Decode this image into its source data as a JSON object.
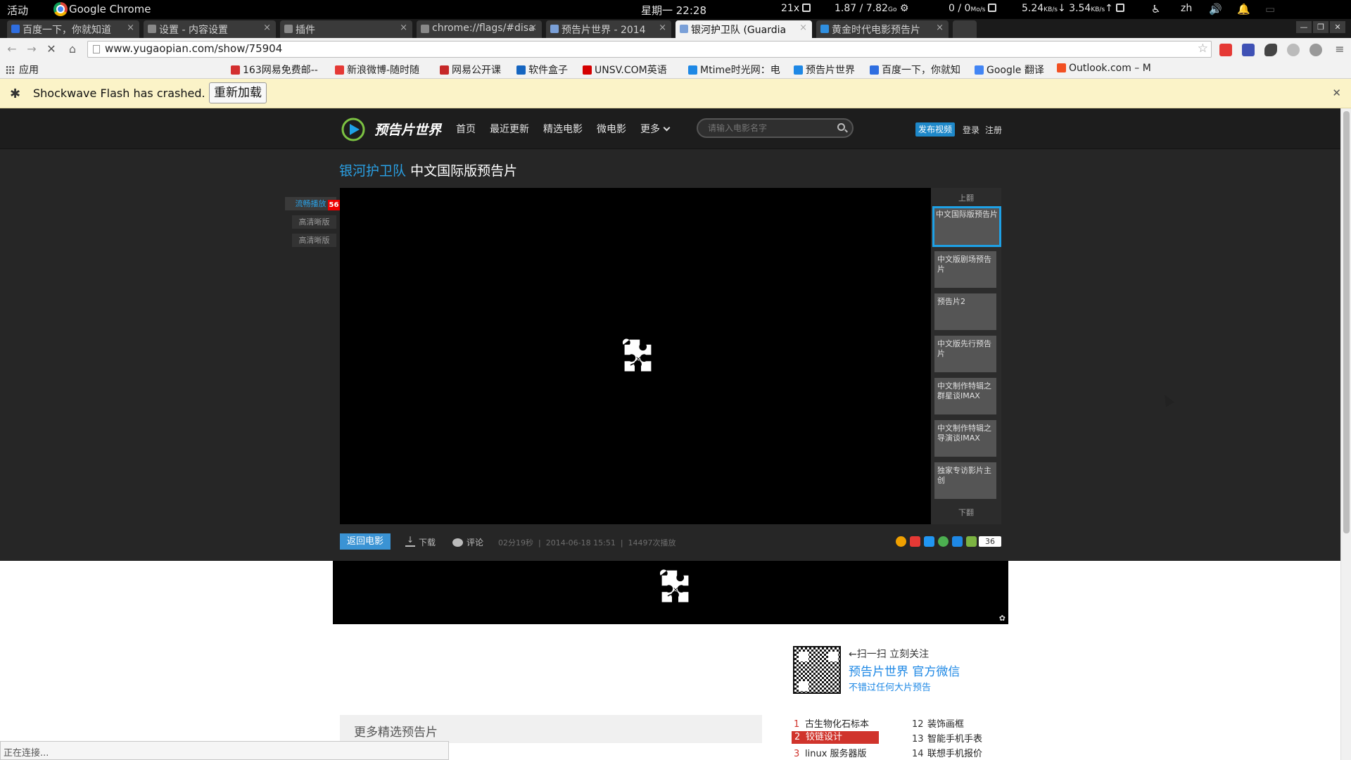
{
  "topbar": {
    "activities": "活动",
    "app_name": "Google Chrome",
    "clock": "星期一 22:28",
    "s1": "21x",
    "s2": "1.87 / 7.82",
    "s2_unit": "Go",
    "s3": "0 / 0",
    "s3_unit": "Mo/s",
    "down": "5.24",
    "up": "3.54",
    "net_unit": "KB/s",
    "lang": "zh"
  },
  "tabs": [
    {
      "label": "百度一下，你就知道",
      "color": "#2f6ee0"
    },
    {
      "label": "设置 - 内容设置",
      "color": "#888888"
    },
    {
      "label": "插件",
      "color": "#888888"
    },
    {
      "label": "chrome://flags/#disa",
      "color": "#888888"
    },
    {
      "label": "预告片世界 - 2014",
      "color": "#7aa0d8"
    },
    {
      "label": "银河护卫队 (Guardia",
      "color": "#7aa0d8"
    },
    {
      "label": "黄金时代电影预告片",
      "color": "#2f8fe0"
    }
  ],
  "omnibox": {
    "url": "www.yugaopian.com/show/75904"
  },
  "bookmarks": {
    "apps_label": "应用",
    "items": [
      {
        "label": "163网易免费邮--",
        "color": "#d32f2f"
      },
      {
        "label": "新浪微博-随时随",
        "color": "#e53935"
      },
      {
        "label": "网易公开课",
        "color": "#c62828"
      },
      {
        "label": "软件盒子",
        "color": "#1565c0"
      },
      {
        "label": "UNSV.COM英语",
        "color": "#d50000"
      },
      {
        "label": "Mtime时光网：电",
        "color": "#1e88e5"
      },
      {
        "label": "预告片世界",
        "color": "#1e88e5"
      },
      {
        "label": "百度一下，你就知",
        "color": "#2f6ee0"
      },
      {
        "label": "Google 翻译",
        "color": "#4285f4"
      },
      {
        "label": "Outlook.com – M",
        "color": "#f25022"
      }
    ]
  },
  "infobar": {
    "message": "Shockwave Flash has crashed.",
    "reload": "重新加载"
  },
  "site": {
    "logo": "预告片世界",
    "nav": [
      "首页",
      "最近更新",
      "精选电影",
      "微电影",
      "更多"
    ],
    "search_placeholder": "请输入电影名字",
    "publish": "发布视频",
    "login": "登录",
    "register": "注册"
  },
  "movie": {
    "name": "银河护卫队",
    "version": "中文国际版预告片"
  },
  "sources": {
    "items": [
      "流畅播放",
      "高清晰版",
      "高清晰版"
    ],
    "badge": "56"
  },
  "playlist": {
    "prev": "上翻",
    "next": "下翻",
    "items": [
      "中文国际版预告片",
      "中文版剧场预告片",
      "预告片2",
      "中文版先行预告片",
      "中文制作特辑之群星谈IMAX",
      "中文制作特辑之导演谈IMAX",
      "独家专访影片主创"
    ]
  },
  "playerbar": {
    "back": "返回电影",
    "download": "下载",
    "comment": "评论",
    "duration": "02分19秒",
    "date": "2014-06-18 15:51",
    "plays": "14497次播放",
    "share_count": "36",
    "share_colors": [
      "#f0a000",
      "#e53935",
      "#2196f3",
      "#4caf50",
      "#1e88e5",
      "#7cb342"
    ]
  },
  "wechat": {
    "scan": "←扫一扫 立刻关注",
    "title": "预告片世界 官方微信",
    "subtitle": "不错过任何大片预告"
  },
  "more": {
    "title": "更多精选预告片"
  },
  "ranking": {
    "left": [
      {
        "n": "1",
        "t": "古生物化石标本"
      },
      {
        "n": "2",
        "t": "铰链设计"
      },
      {
        "n": "3",
        "t": "linux 服务器版"
      }
    ],
    "right": [
      {
        "n": "12",
        "t": "装饰画框"
      },
      {
        "n": "13",
        "t": "智能手机手表"
      },
      {
        "n": "14",
        "t": "联想手机报价"
      }
    ]
  },
  "status": "正在连接..."
}
